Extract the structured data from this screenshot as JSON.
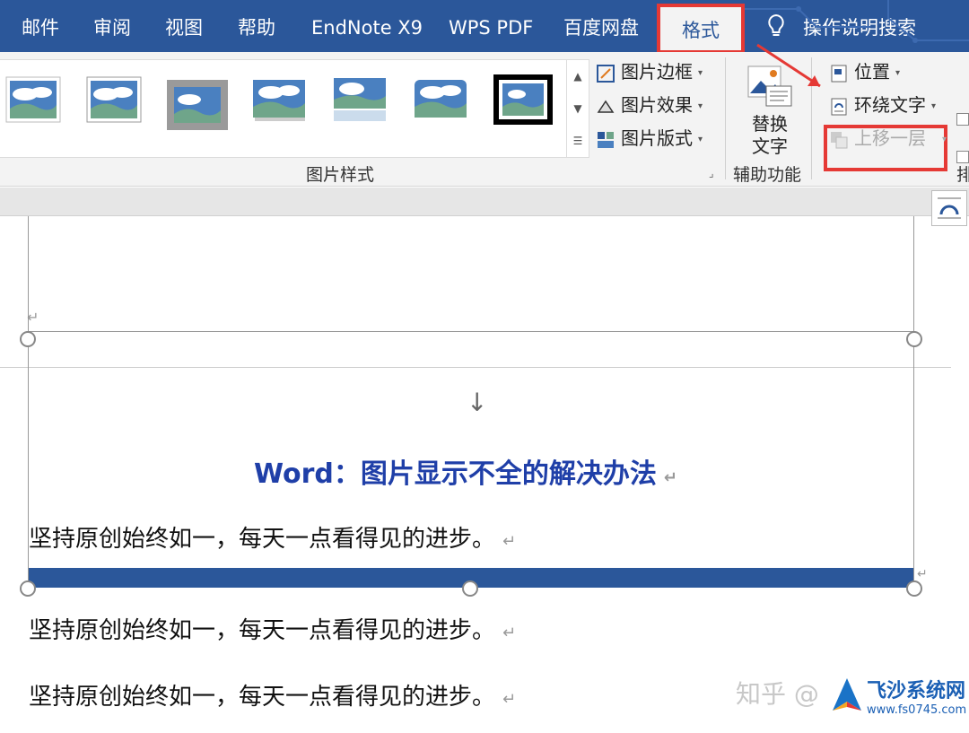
{
  "tabs": {
    "mail": "邮件",
    "review": "审阅",
    "view": "视图",
    "help": "帮助",
    "endnote": "EndNote X9",
    "wps_pdf": "WPS PDF",
    "baidu": "百度网盘",
    "format": "格式",
    "search": "操作说明搜索"
  },
  "ribbon": {
    "picture_border": "图片边框",
    "picture_effect": "图片效果",
    "picture_layout": "图片版式",
    "picture_styles_group": "图片样式",
    "alt_text_line1": "替换",
    "alt_text_line2": "文字",
    "accessibility_group": "辅助功能",
    "position": "位置",
    "wrap_text": "环绕文字",
    "bring_forward": "上移一层",
    "arrange_partial": "排"
  },
  "document": {
    "arrow_symbol": "↓",
    "title": "Word：图片显示不全的解决办法",
    "paragraph1": "坚持原创始终如一，每天一点看得见的进步。",
    "paragraph2": "坚持原创始终如一，每天一点看得见的进步。",
    "paragraph3": "坚持原创始终如一，每天一点看得见的进步。",
    "para_mark": "↵"
  },
  "watermark": {
    "zhihu": "知乎 @",
    "site_name": "飞沙系统网",
    "site_url": "www.fs0745.com"
  },
  "colors": {
    "tab_bar": "#2b579a",
    "highlight": "#e53935",
    "title_blue": "#1f3fa8",
    "image_band": "#2b579a"
  }
}
